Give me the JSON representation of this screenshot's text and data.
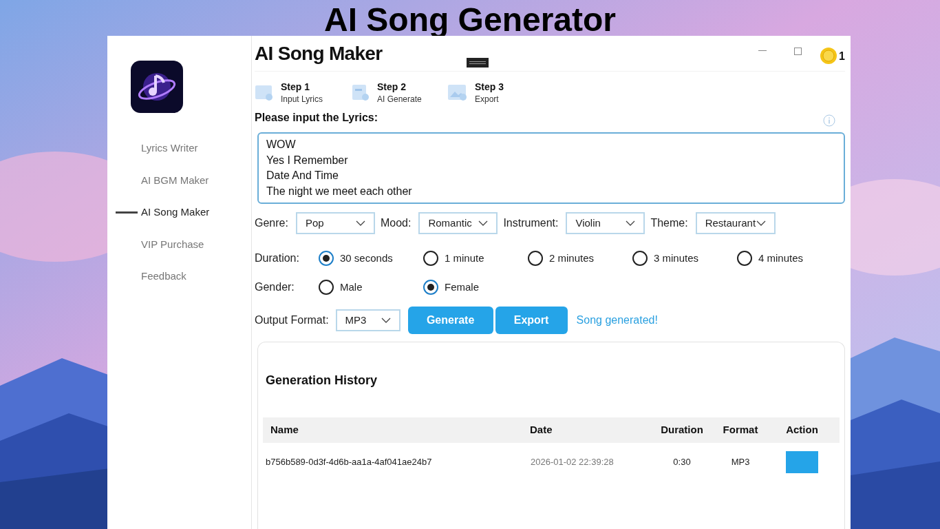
{
  "banner_title": "AI Song Generator",
  "window": {
    "title": "AI Song Maker",
    "coin_count": "1"
  },
  "sidebar": {
    "items": [
      {
        "label": "Lyrics Writer",
        "selected": false
      },
      {
        "label": "AI BGM Maker",
        "selected": false
      },
      {
        "label": "AI Song Maker",
        "selected": true
      },
      {
        "label": "VIP Purchase",
        "selected": false
      },
      {
        "label": "Feedback",
        "selected": false
      }
    ]
  },
  "steps": [
    {
      "title": "Step 1",
      "subtitle": "Input Lyrics",
      "kind": "lyrics"
    },
    {
      "title": "Step 2",
      "subtitle": "AI Generate",
      "kind": "generate"
    },
    {
      "title": "Step 3",
      "subtitle": "Export",
      "kind": "export"
    }
  ],
  "lyrics": {
    "label": "Please input the Lyrics:",
    "value": "WOW\nYes I Remember\nDate And Time\nThe night we meet each other"
  },
  "selects": [
    {
      "label": "Genre:",
      "value": "Pop"
    },
    {
      "label": "Mood:",
      "value": "Romantic"
    },
    {
      "label": "Instrument:",
      "value": "Violin"
    },
    {
      "label": "Theme:",
      "value": "Restaurant"
    }
  ],
  "duration": {
    "label": "Duration:",
    "options": [
      {
        "label": "30 seconds",
        "selected": true
      },
      {
        "label": "1 minute",
        "selected": false
      },
      {
        "label": "2 minutes",
        "selected": false
      },
      {
        "label": "3 minutes",
        "selected": false
      },
      {
        "label": "4 minutes",
        "selected": false
      }
    ]
  },
  "gender": {
    "label": "Gender:",
    "options": [
      {
        "label": "Male",
        "selected": false
      },
      {
        "label": "Female",
        "selected": true
      }
    ]
  },
  "output_format": {
    "label": "Output Format:",
    "value": "MP3"
  },
  "buttons": [
    "Generate",
    "Export"
  ],
  "status": "Song generated!",
  "history": {
    "title": "Generation History",
    "columns": [
      "Name",
      "Date",
      "Duration",
      "Format",
      "Action"
    ],
    "rows": [
      {
        "name": "b756b589-0d3f-4d6b-aa1a-4af041ae24b7",
        "date": "2026-01-02 22:39:28",
        "duration": "0:30",
        "format": "MP3"
      }
    ]
  }
}
